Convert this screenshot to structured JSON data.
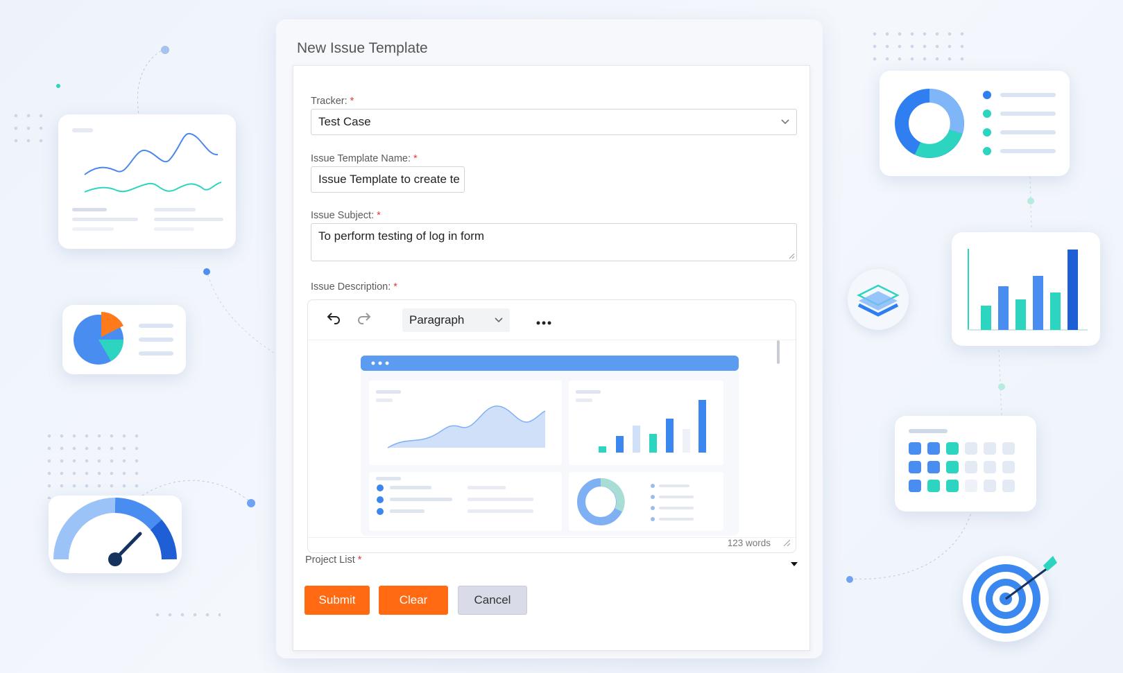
{
  "form": {
    "title": "New Issue Template",
    "tracker": {
      "label": "Tracker:",
      "value": "Test Case"
    },
    "template_name": {
      "label": "Issue Template Name:",
      "value": "Issue Template to create te"
    },
    "subject": {
      "label": "Issue Subject:",
      "value": "To perform testing of log in form"
    },
    "description": {
      "label": "Issue Description:",
      "format_selected": "Paragraph",
      "word_count": "123 words"
    },
    "project_list": {
      "label": "Project List"
    },
    "required_mark": "*",
    "buttons": {
      "submit": "Submit",
      "clear": "Clear",
      "cancel": "Cancel"
    }
  },
  "icons": {
    "undo": "undo-icon",
    "redo": "redo-icon",
    "more": "more-options-icon",
    "chevron": "chevron-down-icon",
    "dropdown_caret": "caret-down-icon"
  },
  "colors": {
    "accent_orange": "#ff6a13",
    "cancel_grey": "#d9dce8",
    "required_red": "#e53935",
    "blue": "#3b82f6",
    "teal": "#2dd4bf"
  }
}
